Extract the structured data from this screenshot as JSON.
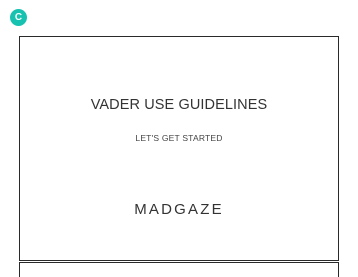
{
  "step_badge": {
    "label": "C",
    "color": "#17c2b0"
  },
  "screen": {
    "title": "VADER USE GUIDELINES",
    "subtitle": "LET'S GET STARTED",
    "logo": "MADGAZE"
  }
}
